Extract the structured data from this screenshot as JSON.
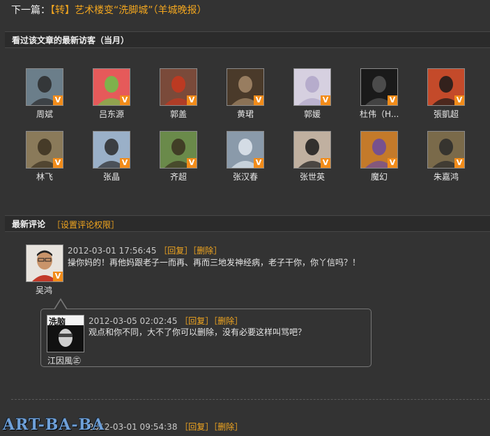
{
  "nav": {
    "prefix": "下一篇：",
    "link_text": "【转】艺术楼变“洗脚城”（羊城晚报）"
  },
  "visitors_section": {
    "title": "看过该文章的最新访客（当月）",
    "visitors": [
      {
        "name": "周斌",
        "bg": "#6b7e8a",
        "fg": "#2a2a2a"
      },
      {
        "name": "吕东源",
        "bg": "#e65a5a",
        "fg": "#6cc24a"
      },
      {
        "name": "郭盖",
        "bg": "#7a4a3a",
        "fg": "#c8371f"
      },
      {
        "name": "黄珺",
        "bg": "#4a3a2a",
        "fg": "#a68a6a"
      },
      {
        "name": "郭媛",
        "bg": "#d6d0e0",
        "fg": "#b0a6c8"
      },
      {
        "name": "杜伟（H...",
        "bg": "#1a1a1a",
        "fg": "#555555"
      },
      {
        "name": "張凱超",
        "bg": "#c44a2a",
        "fg": "#1a1a1a"
      },
      {
        "name": "林飞",
        "bg": "#8a7a5a",
        "fg": "#3a3020"
      },
      {
        "name": "张晶",
        "bg": "#9ab0c8",
        "fg": "#2a2a2a"
      },
      {
        "name": "齐超",
        "bg": "#6a8a4a",
        "fg": "#3a3020"
      },
      {
        "name": "张汉春",
        "bg": "#8a9aaa",
        "fg": "#e0e8f0"
      },
      {
        "name": "张世英",
        "bg": "#c0b0a0",
        "fg": "#1a1a1a"
      },
      {
        "name": "魔幻",
        "bg": "#c47a2a",
        "fg": "#6a4aa0"
      },
      {
        "name": "朱嘉鸿",
        "bg": "#7a6a4a",
        "fg": "#2a2a2a"
      }
    ],
    "badge": "V"
  },
  "comments_section": {
    "title": "最新评论",
    "permission_link": "［设置评论权限］",
    "reply_label": "［回复］",
    "delete_label": "［删除］",
    "comments": [
      {
        "author": "吴鸿",
        "time": "2012-03-01 17:56:45",
        "text": "操你妈的！再他妈跟老子一而再、再而三地发神经病，老子干你，你丫信吗？！"
      },
      {
        "author": "",
        "time": "2012-03-01 09:54:38",
        "text": ""
      }
    ],
    "reply": {
      "author": "江因風㊣",
      "avatar_text": "洗脑",
      "time": "2012-03-05 02:02:45",
      "text": "观点和你不同，大不了你可以删除，没有必要这样叫骂吧？"
    }
  },
  "watermark": "ART-BA-BA"
}
